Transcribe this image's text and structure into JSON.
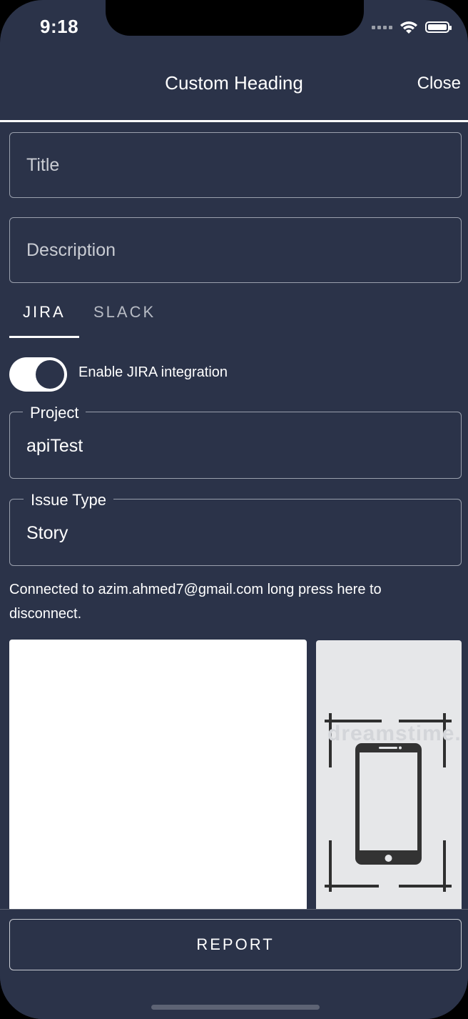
{
  "status_bar": {
    "time": "9:18",
    "signal_icon": "signal-icon",
    "wifi_icon": "wifi-icon",
    "battery_icon": "battery-icon"
  },
  "header": {
    "title": "Custom Heading",
    "close_label": "Close"
  },
  "form": {
    "title_placeholder": "Title",
    "title_value": "",
    "description_placeholder": "Description",
    "description_value": ""
  },
  "tabs": [
    {
      "label": "JIRA",
      "active": true
    },
    {
      "label": "SLACK",
      "active": false
    }
  ],
  "jira": {
    "toggle_label": "Enable JIRA integration",
    "toggle_on": true,
    "project_label": "Project",
    "project_value": "apiTest",
    "issue_type_label": "Issue Type",
    "issue_type_value": "Story",
    "connected_text": "Connected to azim.ahmed7@gmail.com long press here to disconnect."
  },
  "screenshot_thumb": {
    "icon": "phone-screenshot-icon",
    "watermark": "dreamstime."
  },
  "actions": {
    "report_label": "REPORT"
  },
  "colors": {
    "background": "#2b3349",
    "text": "#ffffff",
    "border": "#9aa0ad"
  }
}
